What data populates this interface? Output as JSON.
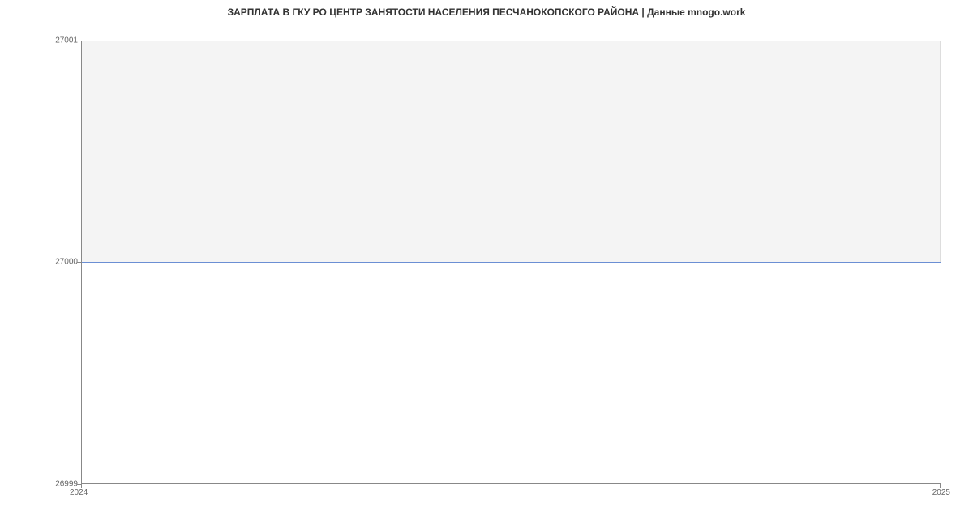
{
  "chart_data": {
    "type": "area",
    "title": "ЗАРПЛАТА В ГКУ РО ЦЕНТР ЗАНЯТОСТИ НАСЕЛЕНИЯ ПЕСЧАНОКОПСКОГО РАЙОНА | Данные mnogo.work",
    "x": [
      2024,
      2025
    ],
    "values": [
      27000,
      27000
    ],
    "xlabel": "",
    "ylabel": "",
    "ylim": [
      26999,
      27001
    ],
    "xlim": [
      2024,
      2025
    ],
    "y_ticks": [
      "26999",
      "27000",
      "27001"
    ],
    "x_ticks": [
      "2024",
      "2025"
    ]
  }
}
